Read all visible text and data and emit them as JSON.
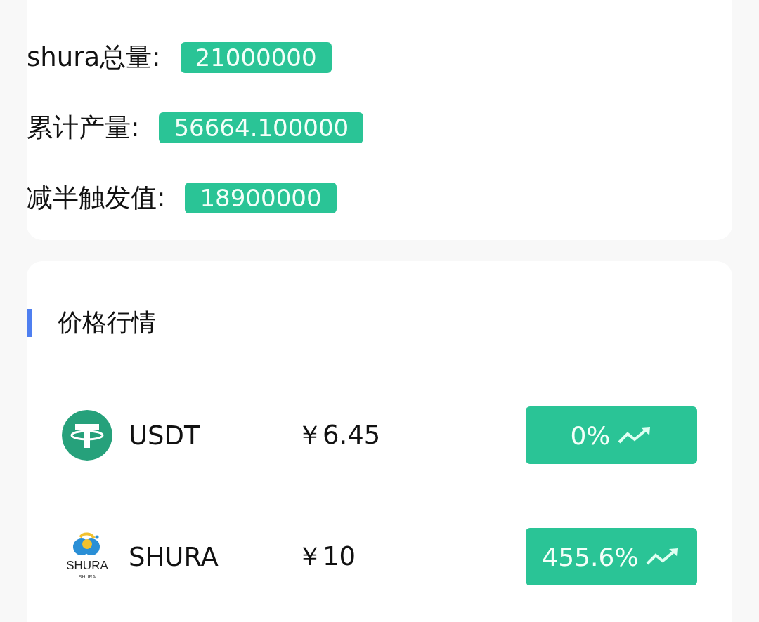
{
  "supply": [
    {
      "label": "shura总量:",
      "value": "21000000"
    },
    {
      "label": "累计产量:",
      "value": "56664.100000"
    },
    {
      "label": "减半触发值:",
      "value": "18900000"
    }
  ],
  "market": {
    "title": "价格行情",
    "rows": [
      {
        "kind": "usdt",
        "name": "USDT",
        "price": "￥6.45",
        "change": "0%"
      },
      {
        "kind": "shura",
        "logo_text": "SHURA",
        "logo_subtext": "SHURA",
        "name": "SHURA",
        "price": "￥10",
        "change": "455.6%"
      }
    ]
  }
}
